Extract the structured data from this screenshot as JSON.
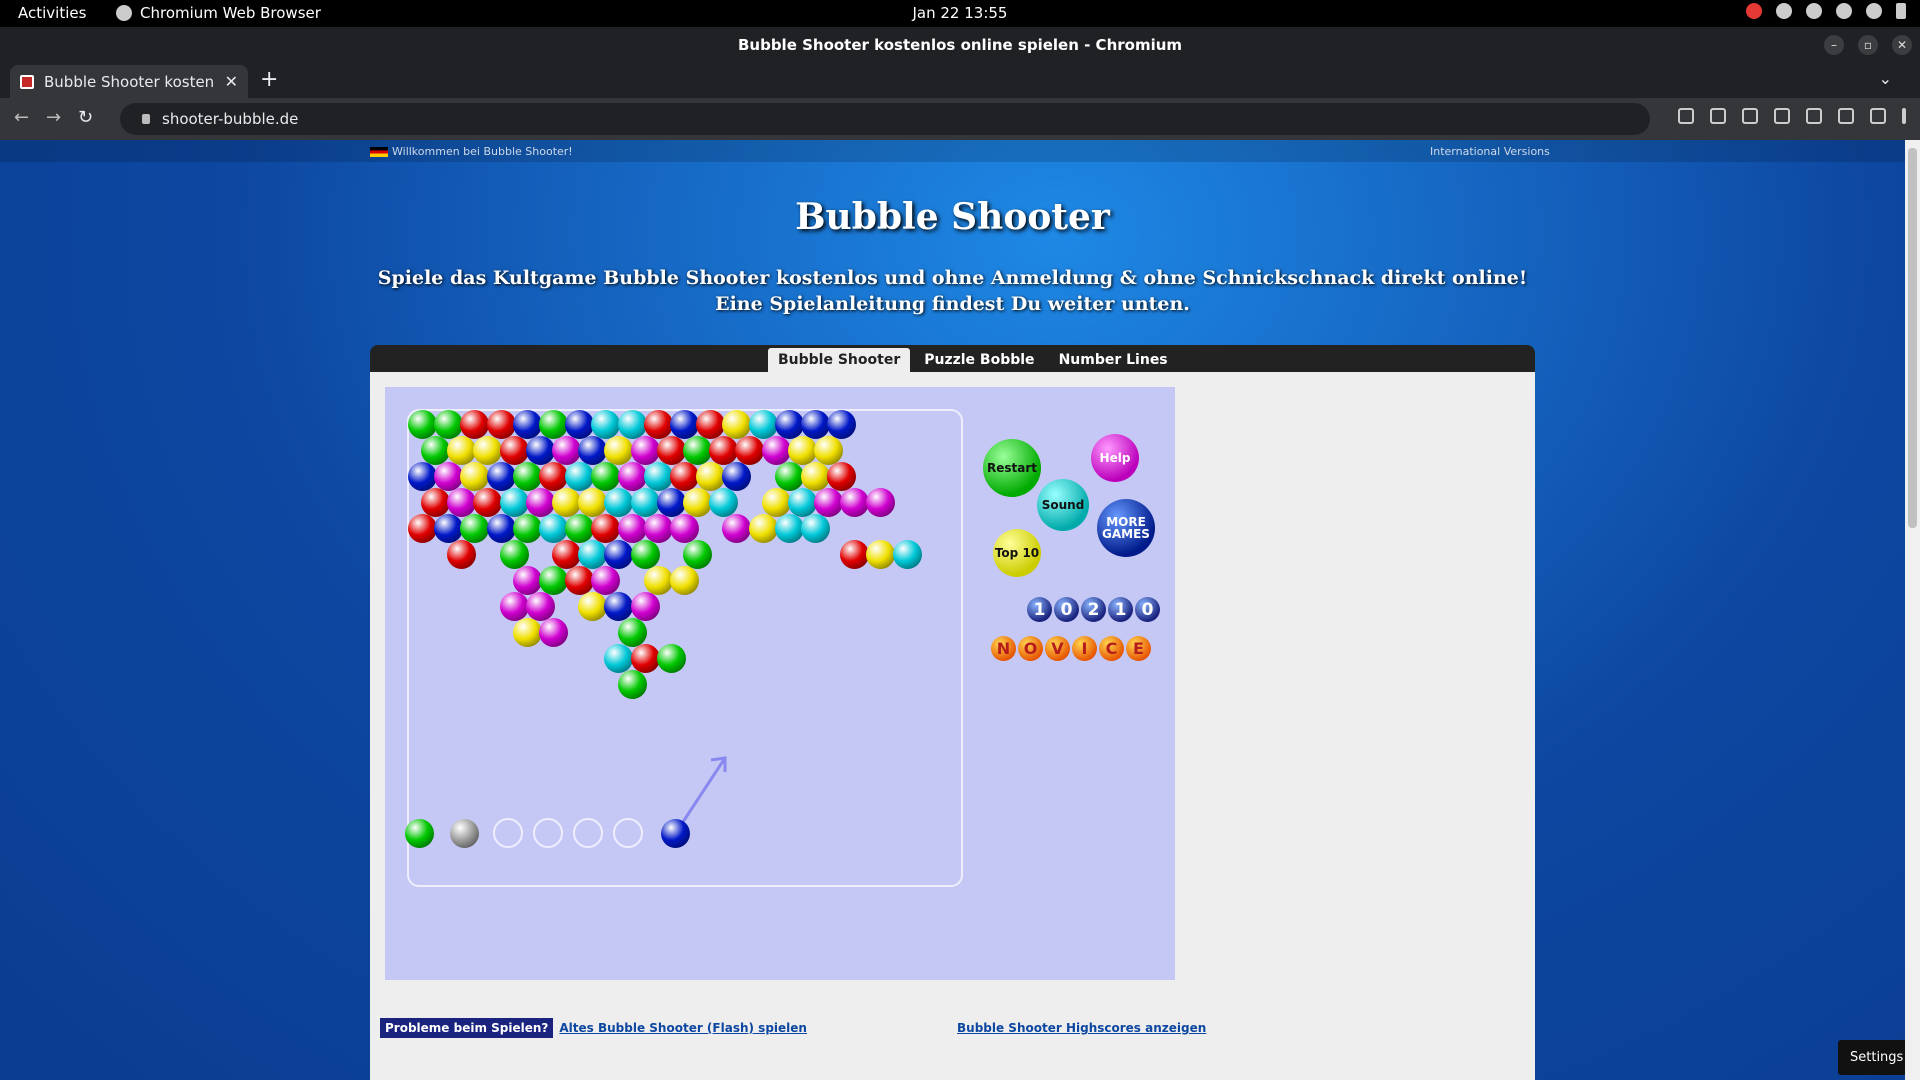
{
  "os": {
    "activities": "Activities",
    "app_name": "Chromium Web Browser",
    "clock": "Jan 22  13:55"
  },
  "window": {
    "title": "Bubble Shooter kostenlos online spielen - Chromium"
  },
  "tab": {
    "title": "Bubble Shooter kostenlos online spielen"
  },
  "address": {
    "url": "shooter-bubble.de"
  },
  "page": {
    "welcome": "Willkommen bei Bubble Shooter!",
    "intl": "International Versions",
    "title": "Bubble Shooter",
    "subtitle": "Spiele das Kultgame Bubble Shooter kostenlos und ohne Anmeldung & ohne Schnickschnack direkt online! Eine Spielanleitung findest Du weiter unten.",
    "tabs": [
      "Bubble Shooter",
      "Puzzle Bobble",
      "Number Lines"
    ]
  },
  "game": {
    "buttons": {
      "restart": "Restart",
      "help": "Help",
      "sound": "Sound",
      "more": "MORE GAMES",
      "top10": "Top 10"
    },
    "score": [
      "1",
      "0",
      "2",
      "1",
      "0"
    ],
    "level": [
      "N",
      "O",
      "V",
      "I",
      "C",
      "E"
    ],
    "colors": {
      "g": "#00c800",
      "r": "#e00000",
      "b": "#0018c8",
      "c": "#00c8d8",
      "y": "#f0e000",
      "m": "#d000d0",
      "s": "#a0a0a0"
    },
    "grid": [
      "ggrrbgbccrbrycbbb",
      "gyyrbmbymrgrrmyy",
      "bmybgrcgmcryb.gyr",
      "rmrcmyyccbyc.ycmmm",
      "rbgbgcgrmmm.mycc",
      ".r.g.rcbg.g.....ryc",
      "....mgrm.yy",
      "...mm.ybm",
      "....ym..g",
      ".......crg",
      "........g"
    ],
    "queue_colors": [
      "g",
      "s"
    ],
    "shooter_color": "b"
  },
  "footer": {
    "problems": "Probleme beim Spielen?",
    "flash": "Altes Bubble Shooter (Flash) spielen",
    "highscores": "Bubble Shooter Highscores anzeigen",
    "settings": "Settings"
  }
}
